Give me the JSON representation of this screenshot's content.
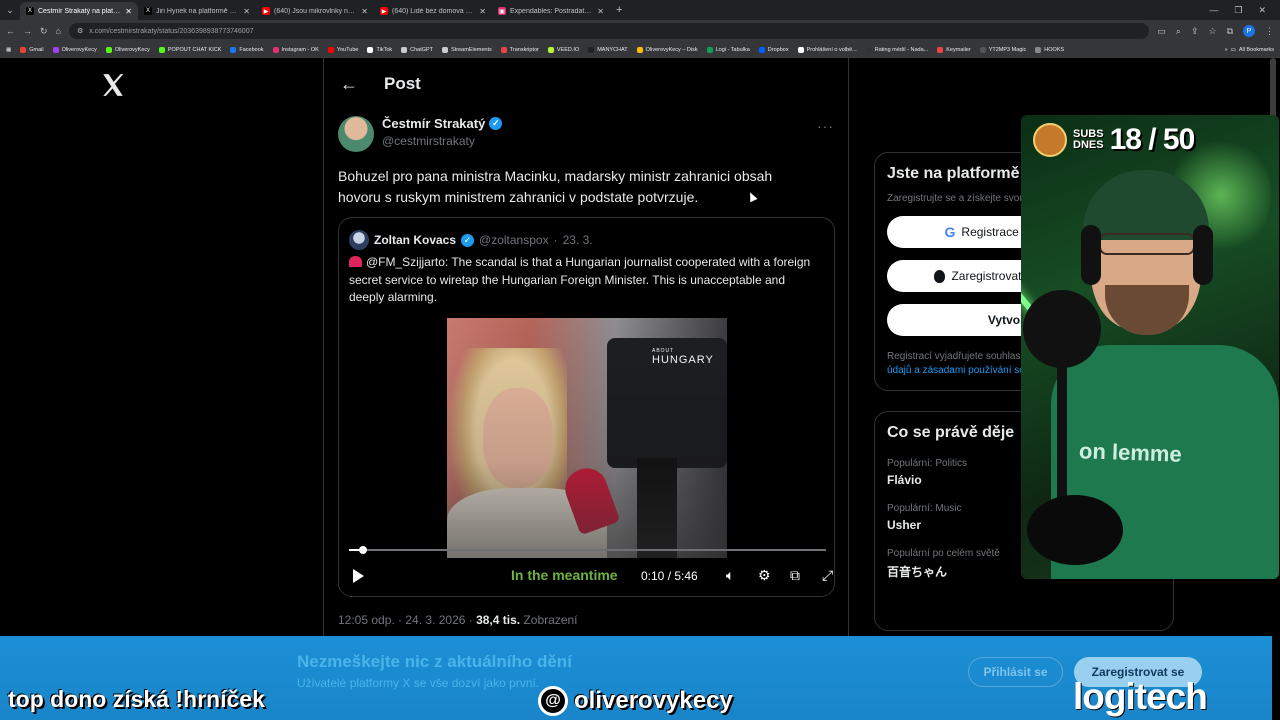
{
  "browser": {
    "tabs": [
      {
        "title": "Čestmír Strakatý na platformě X",
        "favicon_color": "#000000",
        "favicon_glyph": "X",
        "active": true
      },
      {
        "title": "Jiri Hynek na platformě X: „Ma",
        "favicon_color": "#000000",
        "favicon_glyph": "X",
        "active": false
      },
      {
        "title": "(640) Jsou mikrovlnky nebezp",
        "favicon_color": "#ff0000",
        "favicon_glyph": "▶",
        "active": false
      },
      {
        "title": "(640) Lidé bez domova v rámci",
        "favicon_color": "#ff0000",
        "favicon_glyph": "▶",
        "active": false
      },
      {
        "title": "Expendables: Postradatelní (20",
        "favicon_color": "#d93070",
        "favicon_glyph": "▣",
        "active": false
      }
    ],
    "url": "x.com/cestmirstrakaty/status/2036398938773746007",
    "profile_letter": "P",
    "bookmarks": [
      {
        "label": "Gmail",
        "color": "#ea4335"
      },
      {
        "label": "OliverovyKecy",
        "color": "#a142f4"
      },
      {
        "label": "OliverovyKecy",
        "color": "#53fc18"
      },
      {
        "label": "POPOUT CHAT KICK",
        "color": "#53fc18"
      },
      {
        "label": "Facebook",
        "color": "#1877f2"
      },
      {
        "label": "Instagram - OK",
        "color": "#e1306c"
      },
      {
        "label": "YouTube",
        "color": "#ff0000"
      },
      {
        "label": "TikTok",
        "color": "#ffffff"
      },
      {
        "label": "ChatGPT",
        "color": "#cccccc"
      },
      {
        "label": "StreamElements",
        "color": "#cccccc"
      },
      {
        "label": "Transkriptor",
        "color": "#e44"
      },
      {
        "label": "VEED.IO",
        "color": "#b5f23d"
      },
      {
        "label": "MANYCHAT",
        "color": "#222222"
      },
      {
        "label": "OliverovyKecy – Disk",
        "color": "#fbbc04"
      },
      {
        "label": "Logi - Tabulka",
        "color": "#0f9d58"
      },
      {
        "label": "Dropbox",
        "color": "#0061ff"
      },
      {
        "label": "Prohlášení o volbě...",
        "color": "#ffffff"
      },
      {
        "label": "Rating médií - Nada...",
        "color": "#333333"
      },
      {
        "label": "Keymailer",
        "color": "#e44"
      },
      {
        "label": "YT2MP3 Magic",
        "color": "#555555"
      },
      {
        "label": "HOOKS",
        "color": "#888888"
      }
    ],
    "all_bookmarks": "All Bookmarks"
  },
  "post": {
    "header_title": "Post",
    "author_name": "Čestmír Strakatý",
    "author_handle": "@cestmirstrakaty",
    "text": "Bohuzel pro pana ministra Macinku, madarsky ministr zahranici obsah hovoru s ruskym ministrem zahranici v podstate potvrzuje.",
    "more": "···",
    "timestamp": "12:05 odp. · 24. 3. 2026 · ",
    "views_count": "38,4 tis.",
    "views_label": " Zobrazení"
  },
  "quote": {
    "author_name": "Zoltan Kovacs",
    "author_handle": "@zoltanspox",
    "separator": "·",
    "date": "23. 3.",
    "text": "@FM_Szijjarto: The scandal is that a Hungarian journalist cooperated with a foreign secret service to wiretap the Hungarian Foreign Minister. This is unacceptable and deeply alarming.",
    "video": {
      "watermark_small": "ABOUT",
      "watermark": "HUNGARY",
      "caption": "In the meantime",
      "time": "0:10 / 5:46",
      "progress": 0.03
    }
  },
  "sidebar": {
    "signup_title": "Jste na platformě X nově?",
    "signup_sub": "Zaregistrujte se a získejte svou vlastní časovou osu!",
    "google_btn": "Registrace pomocí Googlu",
    "apple_btn": "Zaregistrovat se pomocí Apple",
    "create_btn": "Vytvořit účet",
    "legal_text": "Registrací vyjadřujete souhlas s ",
    "legal_link": "zásadami ochrany osobních údajů a zásadami používání souborů cookie.",
    "trending_title": "Co se právě děje",
    "trends": [
      {
        "category": "Populární: Politics",
        "name": "Flávio"
      },
      {
        "category": "Populární: Music",
        "name": "Usher"
      },
      {
        "category": "Populární po celém světě",
        "name": "百音ちゃん"
      }
    ]
  },
  "banner": {
    "title": "Nezmeškejte nic z aktuálního dění",
    "subtitle": "Uživatelé platformy X se vše dozví jako první.",
    "login": "Přihlásit se",
    "signup": "Zaregistrovat se"
  },
  "stream_overlay": {
    "subs_label_1": "SUBS",
    "subs_label_2": "DNES",
    "subs_count": "18 / 50",
    "shirt_text": "on lemme",
    "left_text": "top dono získá !hrníček",
    "handle": "oliverovykecy",
    "sponsor": "logitech"
  }
}
